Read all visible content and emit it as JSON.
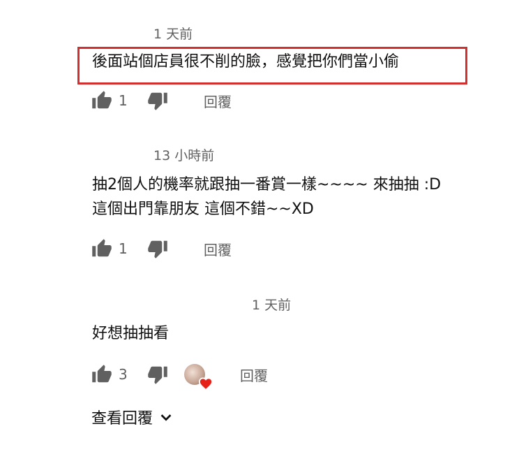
{
  "comments": [
    {
      "timestamp": "1 天前",
      "text_lines": [
        "後面站個店員很不削的臉，感覺把你們當小偷"
      ],
      "likes": "1",
      "reply_label": "回覆"
    },
    {
      "timestamp": "13 小時前",
      "text_lines": [
        "抽2個人的機率就跟抽一番賞一樣~~~~  來抽抽 :D",
        "這個出門靠朋友 這個不錯~~XD"
      ],
      "likes": "1",
      "reply_label": "回覆"
    },
    {
      "timestamp": "1 天前",
      "text_lines": [
        "好想抽抽看"
      ],
      "likes": "3",
      "reply_label": "回覆",
      "has_creator_heart": true
    }
  ],
  "view_replies_label": "查看回覆",
  "colors": {
    "highlight_border": "#d32f2f",
    "heart": "#e62117",
    "secondary_text": "#606060"
  },
  "icons": {
    "like": "thumbs-up-icon",
    "dislike": "thumbs-down-icon",
    "expand": "chevron-down-icon",
    "heart": "heart-icon"
  }
}
